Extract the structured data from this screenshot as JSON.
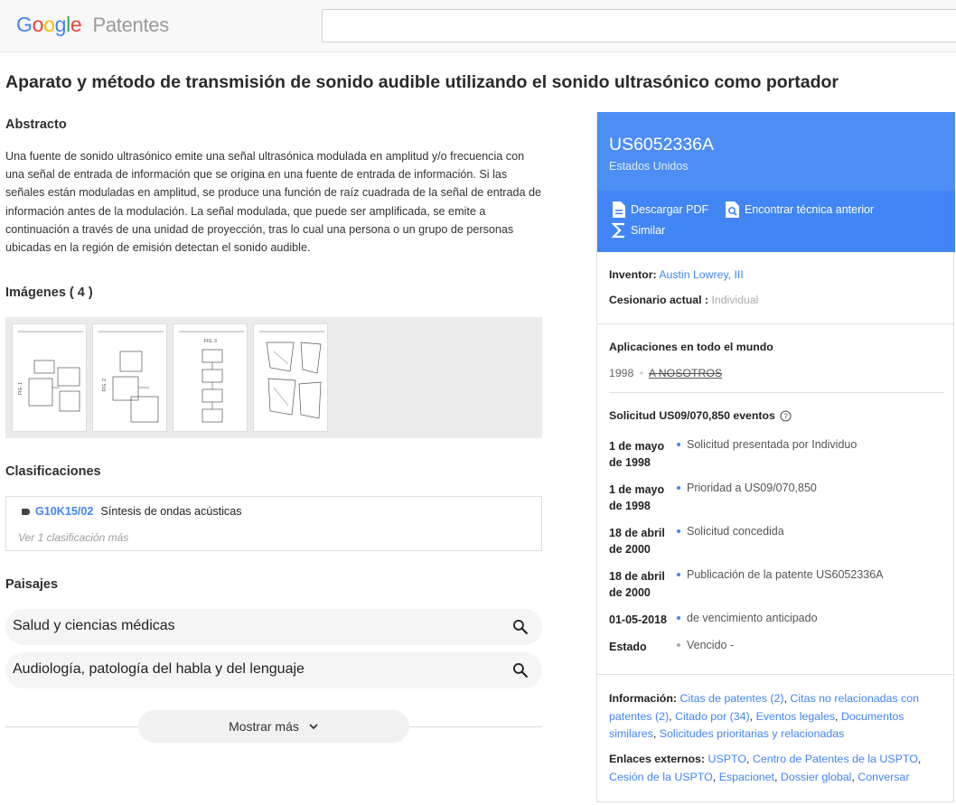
{
  "header": {
    "logo_google_letters": [
      "G",
      "o",
      "o",
      "g",
      "l",
      "e"
    ],
    "logo_colors": [
      "#4285f4",
      "#ea4335",
      "#fbbc05",
      "#4285f4",
      "#34a853",
      "#ea4335"
    ],
    "logo_product": "Patentes",
    "search_value": ""
  },
  "title": "Aparato y método de transmisión de sonido audible utilizando el sonido ultrasónico como portador",
  "abstract": {
    "heading": "Abstracto",
    "text": "Una fuente de sonido ultrasónico emite una señal ultrasónica modulada en amplitud y/o frecuencia con una señal de entrada de información que se origina en una fuente de entrada de información. Si las señales están moduladas en amplitud, se produce una función de raíz cuadrada de la señal de entrada de información antes de la modulación. La señal modulada, que puede ser amplificada, se emite a continuación a través de una unidad de proyección, tras lo cual una persona o un grupo de personas ubicadas en la región de emisión detectan el sonido audible."
  },
  "images": {
    "heading": "Imágenes ( 4 )"
  },
  "classifications": {
    "heading": "Clasificaciones",
    "code": "G10K15/02",
    "description": "Síntesis de ondas acústicas",
    "more": "Ver 1 clasificación más"
  },
  "landscapes": {
    "heading": "Paisajes",
    "items": [
      "Salud y ciencias médicas",
      "Audiología, patología del habla y del lenguaje"
    ]
  },
  "show_more": "Mostrar más",
  "panel": {
    "patent_number": "US6052336A",
    "country": "Estados Unidos",
    "actions": {
      "download": "Descargar PDF",
      "prior_art": "Encontrar técnica anterior",
      "similar": "Similar"
    },
    "inventor_label": "Inventor:",
    "inventor": "Austin Lowrey, III",
    "assignee_label": "Cesionario actual :",
    "assignee": "Individual",
    "worldwide_heading": "Aplicaciones en todo el mundo",
    "worldwide_year": "1998",
    "worldwide_country": "A NOSOTROS",
    "application_events_heading": "Solicitud US09/070,850 eventos",
    "events": [
      {
        "date": "1 de mayo de 1998",
        "text": "Solicitud presentada por Individuo"
      },
      {
        "date": "1 de mayo de 1998",
        "text": "Prioridad a US09/070,850"
      },
      {
        "date": "18 de abril de 2000",
        "text": "Solicitud concedida"
      },
      {
        "date": "18 de abril de 2000",
        "text": "Publicación de la patente US6052336A"
      },
      {
        "date": "01-05-2018",
        "text": "de vencimiento anticipado"
      },
      {
        "date": "Estado",
        "text": "Vencido -"
      }
    ],
    "info_label": "Información:",
    "info_links": [
      "Citas de patentes (2)",
      "Citas no relacionadas con patentes (2)",
      "Citado por (34)",
      "Eventos legales",
      "Documentos similares",
      "Solicitudes prioritarias y relacionadas"
    ],
    "external_label": "Enlaces externos:",
    "external_links": [
      "USPTO",
      "Centro de Patentes de la USPTO",
      "Cesión de la USPTO",
      "Espacionet",
      "Dossier global",
      "Conversar"
    ]
  }
}
